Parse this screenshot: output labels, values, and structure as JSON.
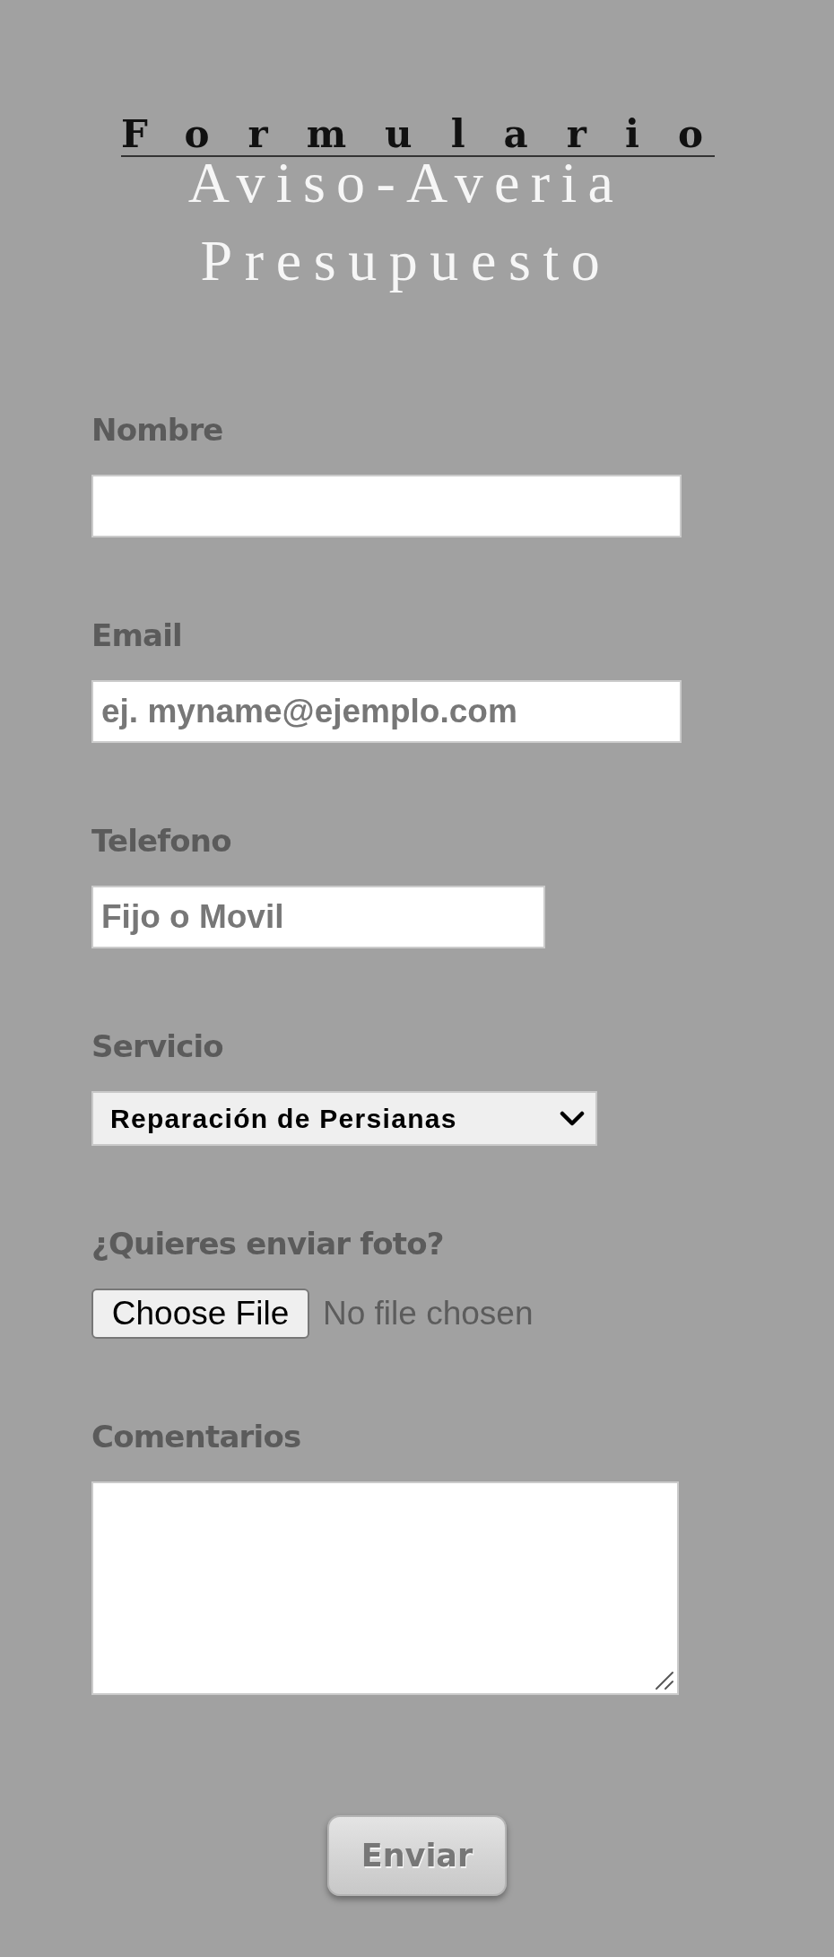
{
  "header": {
    "title": "Formulario",
    "subtitle_lines": [
      "Aviso-Averia",
      "Presupuesto"
    ]
  },
  "fields": [
    {
      "kind": "text",
      "label": "Nombre"
    },
    {
      "kind": "email",
      "label": "Email",
      "placeholder": "ej. myname@ejemplo.com"
    },
    {
      "kind": "tel",
      "label": "Telefono",
      "placeholder": "Fijo o Movil"
    },
    {
      "kind": "select",
      "label": "Servicio",
      "value": "Reparación de Persianas"
    },
    {
      "kind": "file",
      "label": "¿Quieres enviar foto?",
      "button": "Choose File",
      "status": "No file chosen"
    },
    {
      "kind": "textarea",
      "label": "Comentarios"
    }
  ],
  "submit": {
    "label": "Enviar"
  }
}
